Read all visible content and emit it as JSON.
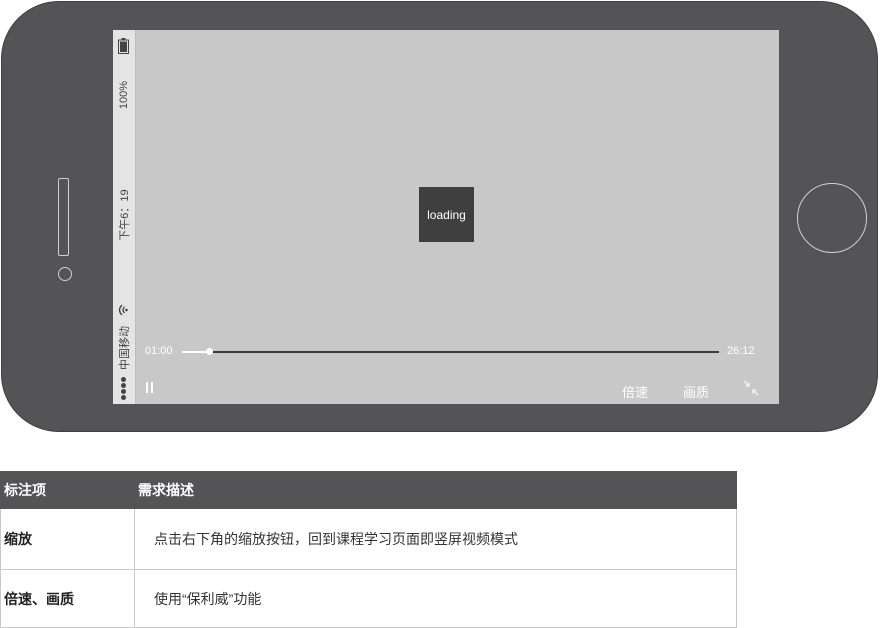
{
  "status_bar": {
    "battery_percent": "100%",
    "time": "下午6：19",
    "carrier": "中国移动"
  },
  "player": {
    "loading_text": "loading",
    "current_time": "01:00",
    "total_time": "26:12",
    "progress_fraction": 0.05,
    "speed_label": "倍速",
    "quality_label": "画质",
    "shrink_icon": "shrink-icon",
    "pause_icon": "pause-icon"
  },
  "table": {
    "headers": [
      "标注项",
      "需求描述"
    ],
    "rows": [
      {
        "label": "缩放",
        "description": "点击右下角的缩放按钮，回到课程学习页面即竖屏视频模式"
      },
      {
        "label": "倍速、画质",
        "description": "使用“保利威”功能"
      }
    ]
  },
  "colors": {
    "phone_body": "#545356",
    "screen_bg": "#c8c8c8",
    "header_bg": "#545356"
  }
}
